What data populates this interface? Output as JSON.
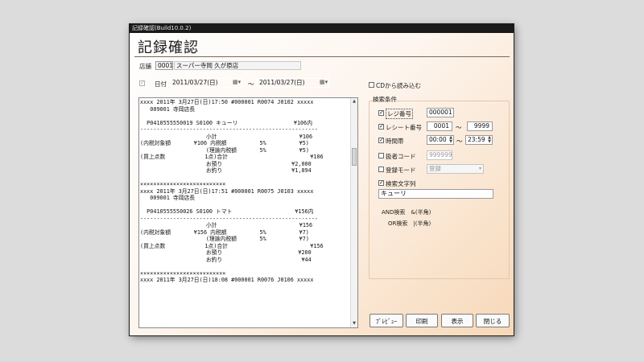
{
  "window": {
    "title": "記録確認(Build10.0.2)",
    "heading": "記録確認"
  },
  "store": {
    "label": "店舗",
    "code": "0001",
    "name": "スーパー寺岡 久が原店"
  },
  "date": {
    "label": "日付",
    "from": "2011/03/27(日)",
    "to": "2011/03/27(日)",
    "separator": "～"
  },
  "cd_read": {
    "label": "CDから読み込む"
  },
  "search": {
    "title": "検索条件",
    "register": {
      "label": "レジ番号",
      "value": "000001",
      "checked": true
    },
    "receipt": {
      "label": "レシート番号",
      "from": "0001",
      "to": "9999",
      "separator": "～",
      "checked": true
    },
    "time": {
      "label": "時間帯",
      "from": "00:00",
      "to": "23:59",
      "separator": "～",
      "checked": true
    },
    "staff": {
      "label": "扱者コード",
      "value": "999999",
      "checked": false
    },
    "mode": {
      "label": "登録モード",
      "value": "登録",
      "checked": false
    },
    "text": {
      "label": "検索文字列",
      "value": "キューリ",
      "checked": true
    },
    "help": {
      "and_line": "AND検索　&(半角)",
      "or_line": "OR検索　|(半角)"
    }
  },
  "receipt_text": "xxxx 2011年 3月27日(日)17:50 #000001 R0074 J0102 xxxxx\n   009001 寺岡店長\n\n  P0410555550019 S0100 キューリ                 ¥106内\n------------------------------------------------------\n                    小計                         ¥106\n(内税対象額       ¥106 内税額          5%          ¥5)\n                    (理論内税額       5%          ¥5)\n(買上点数            1点)合計                         ¥106\n                    お預り                     ¥2,000\n                    お釣り                     ¥1,894\n\n××××××××××××××××××××××××××\nxxxx 2011年 3月27日(日)17:51 #000001 R0075 J0103 xxxxx\n   009001 寺岡店長\n\n  P0410555550026 S0100 トマト                   ¥156内\n------------------------------------------------------\n                    小計                         ¥156\n(内税対象額       ¥156 内税額          5%          ¥7)\n                    (理論内税額       5%          ¥7)\n(買上点数            1点)合計                         ¥156\n                    お預り                       ¥200\n                    お釣り                        ¥44\n\n××××××××××××××××××××××××××\nxxxx 2011年 3月27日(日)18:08 #000001 R0076 J0106 xxxxx",
  "buttons": {
    "preview": "ﾌﾟﾚﾋﾞｭｰ",
    "print": "印刷",
    "display": "表示",
    "close": "閉じる"
  }
}
